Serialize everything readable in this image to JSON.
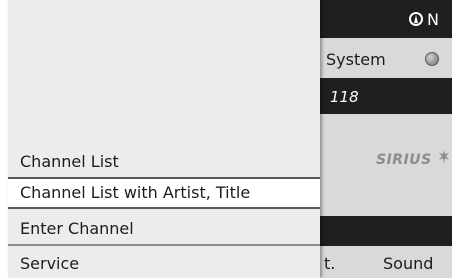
{
  "status_bar": {
    "compass_label": "N"
  },
  "background": {
    "menu_label": "System",
    "channel_number": "118",
    "provider_logo": "SIRIUS",
    "bottom_left_fragment": "t.",
    "sound_label": "Sound"
  },
  "menu": {
    "items": [
      {
        "label": "Channel List"
      },
      {
        "label": "Channel List with Artist, Title"
      },
      {
        "label": "Enter Channel"
      },
      {
        "label": "Service"
      }
    ]
  },
  "colors": {
    "panel": "#ececec",
    "selected": "#ffffff",
    "display_dark": "#2f2f2f",
    "display_light": "#d9d9d9"
  }
}
